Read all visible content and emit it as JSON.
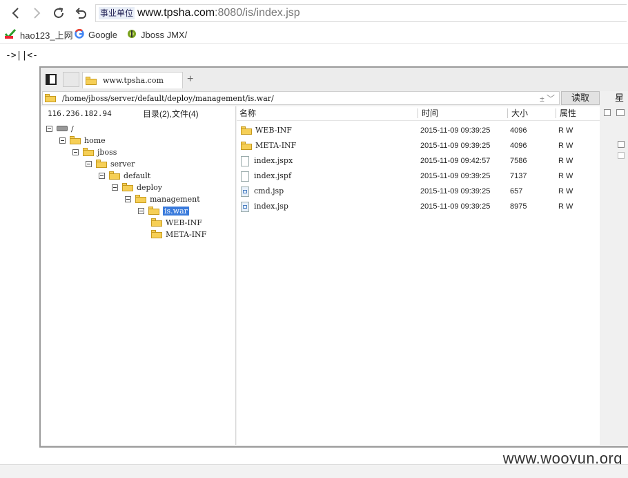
{
  "browser": {
    "site_badge": "事业单位",
    "url_host": "www.tpsha.com",
    "url_rest": ":8080/is/index.jsp"
  },
  "bookmarks": [
    {
      "label": "hao123_上网",
      "icon": "hao123-icon"
    },
    {
      "label": "Google",
      "icon": "google-icon"
    },
    {
      "label": "Jboss JMX/",
      "icon": "jboss-icon"
    }
  ],
  "page_marker": "->||<-",
  "app": {
    "tab_label": "www.tpsha.com",
    "new_tab": "+",
    "path": "/home/jboss/server/default/deploy/management/is.war/",
    "path_extra": "± ﹀",
    "read_button": "读取",
    "week_label": "星期",
    "ip": "116.236.182.94",
    "dir_summary": "目录(2),文件(4)",
    "tree": [
      {
        "label": "/",
        "level": 0,
        "type": "drive"
      },
      {
        "label": "home",
        "level": 1,
        "type": "folder"
      },
      {
        "label": "jboss",
        "level": 2,
        "type": "folder"
      },
      {
        "label": "server",
        "level": 3,
        "type": "folder"
      },
      {
        "label": "default",
        "level": 4,
        "type": "folder"
      },
      {
        "label": "deploy",
        "level": 5,
        "type": "folder"
      },
      {
        "label": "management",
        "level": 6,
        "type": "folder"
      },
      {
        "label": "is.war",
        "level": 7,
        "type": "folder",
        "selected": true
      },
      {
        "label": "WEB-INF",
        "level": 8,
        "type": "folder"
      },
      {
        "label": "META-INF",
        "level": 8,
        "type": "folder"
      }
    ],
    "columns": {
      "name": "名称",
      "time": "时间",
      "size": "大小",
      "attr": "属性"
    },
    "files": [
      {
        "name": "WEB-INF",
        "time": "2015-11-09 09:39:25",
        "size": "4096",
        "attr": "R W",
        "type": "folder"
      },
      {
        "name": "META-INF",
        "time": "2015-11-09 09:39:25",
        "size": "4096",
        "attr": "R W",
        "type": "folder"
      },
      {
        "name": "index.jspx",
        "time": "2015-11-09 09:42:57",
        "size": "7586",
        "attr": "R W",
        "type": "file"
      },
      {
        "name": "index.jspf",
        "time": "2015-11-09 09:39:25",
        "size": "7137",
        "attr": "R W",
        "type": "file"
      },
      {
        "name": "cmd.jsp",
        "time": "2015-11-09 09:39:25",
        "size": "657",
        "attr": "R W",
        "type": "jsp"
      },
      {
        "name": "index.jsp",
        "time": "2015-11-09 09:39:25",
        "size": "8975",
        "attr": "R W",
        "type": "jsp"
      }
    ]
  },
  "watermark": "www.wooyun.org"
}
